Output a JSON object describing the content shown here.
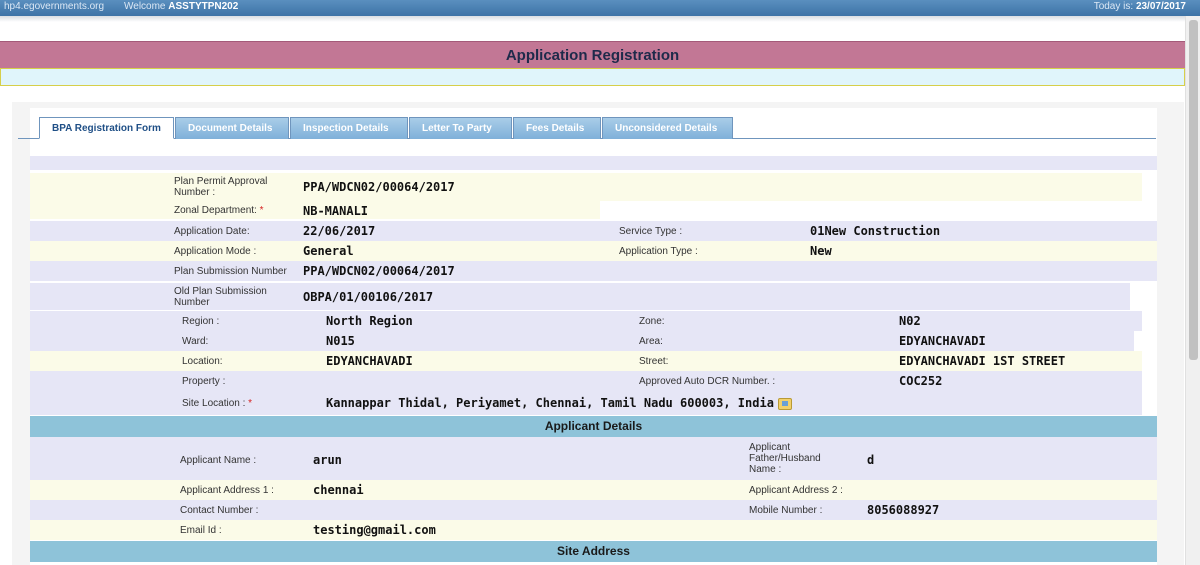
{
  "header": {
    "site": "hp4.egovernments.org",
    "welcome_prefix": "Welcome",
    "user": "ASSTYTPN202",
    "date_prefix": "Today is:",
    "date": "23/07/2017"
  },
  "page": {
    "title": "Application Registration"
  },
  "tabs": [
    {
      "label": "BPA Registration Form",
      "active": true
    },
    {
      "label": "Document Details",
      "active": false
    },
    {
      "label": "Inspection Details",
      "active": false
    },
    {
      "label": "Letter To Party",
      "active": false
    },
    {
      "label": "Fees Details",
      "active": false
    },
    {
      "label": "Unconsidered Details",
      "active": false
    }
  ],
  "form": {
    "ppa_number": {
      "label": "Plan Permit Approval Number :",
      "value": "PPA/WDCN02/00064/2017"
    },
    "zonal_department": {
      "label": "Zonal Department:",
      "required_mark": "*",
      "value": "NB-MANALI"
    },
    "application_date": {
      "label": "Application Date:",
      "value": "22/06/2017"
    },
    "service_type": {
      "label": "Service Type :",
      "value": "01New Construction"
    },
    "application_mode": {
      "label": "Application Mode :",
      "value": "General"
    },
    "application_type": {
      "label": "Application Type :",
      "value": "New"
    },
    "plan_submission_number": {
      "label": "Plan Submission Number",
      "value": "PPA/WDCN02/00064/2017"
    },
    "old_plan_submission_number": {
      "label": "Old Plan Submission Number",
      "value": "OBPA/01/00106/2017"
    },
    "region": {
      "label": "Region :",
      "value": "North Region"
    },
    "zone": {
      "label": "Zone:",
      "value": "N02"
    },
    "ward": {
      "label": "Ward:",
      "value": "N015"
    },
    "area": {
      "label": "Area:",
      "value": "EDYANCHAVADI"
    },
    "location": {
      "label": "Location:",
      "value": "EDYANCHAVADI"
    },
    "street": {
      "label": "Street:",
      "value": "EDYANCHAVADI 1ST STREET"
    },
    "property": {
      "label": "Property :",
      "value": ""
    },
    "approved_auto_dcr": {
      "label": "Approved Auto DCR Number. :",
      "value": "COC252"
    },
    "site_location": {
      "label": "Site Location :",
      "required_mark": "*",
      "value": "Kannappar Thidal, Periyamet, Chennai, Tamil Nadu 600003, India"
    }
  },
  "applicant": {
    "section_title": "Applicant Details",
    "name": {
      "label": "Applicant Name :",
      "value": "arun"
    },
    "father_husband_name": {
      "label": "Applicant Father/Husband Name :",
      "value": "d"
    },
    "address1": {
      "label": "Applicant Address 1 :",
      "value": "chennai"
    },
    "address2": {
      "label": "Applicant Address 2 :",
      "value": ""
    },
    "contact_number": {
      "label": "Contact Number :",
      "value": ""
    },
    "mobile_number": {
      "label": "Mobile Number :",
      "value": "8056088927"
    },
    "email": {
      "label": "Email Id :",
      "value": "testing@gmail.com"
    }
  },
  "site_address": {
    "section_title": "Site Address"
  },
  "icons": {
    "site_location_map": "map-icon"
  }
}
